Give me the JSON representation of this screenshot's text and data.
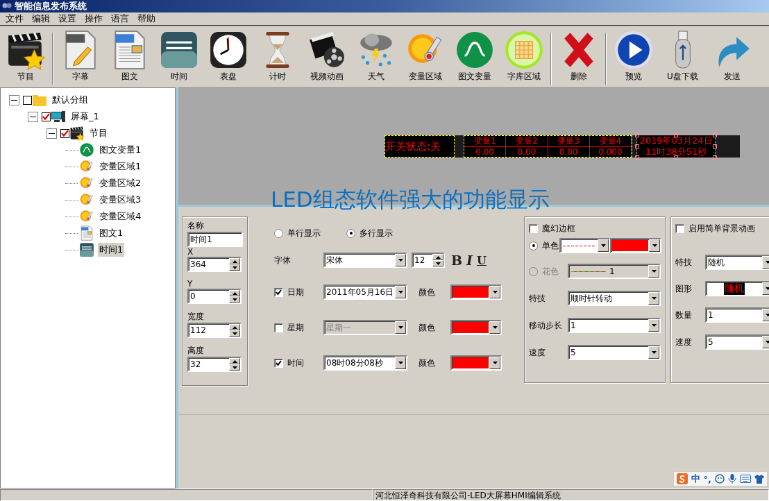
{
  "window": {
    "title": "智能信息发布系统"
  },
  "menu": [
    "文件",
    "编辑",
    "设置",
    "操作",
    "语言",
    "帮助"
  ],
  "toolbar": [
    [
      {
        "label": "节目"
      }
    ],
    [
      {
        "label": "字幕"
      },
      {
        "label": "图文"
      },
      {
        "label": "时间"
      },
      {
        "label": "表盘"
      },
      {
        "label": "计时"
      },
      {
        "label": "视频动画"
      },
      {
        "label": "天气"
      },
      {
        "label": "变量区域"
      },
      {
        "label": "图文变量"
      },
      {
        "label": "字库区域"
      }
    ],
    [
      {
        "label": "删除"
      }
    ],
    [
      {
        "label": "预览"
      },
      {
        "label": "U盘下载"
      },
      {
        "label": "发送"
      }
    ]
  ],
  "tree": [
    {
      "label": "默认分组",
      "kind": "group",
      "checked": false,
      "expanded": true,
      "selected": false,
      "children": [
        {
          "label": "屏幕_1",
          "kind": "screen",
          "checked": true,
          "expanded": true,
          "selected": false,
          "children": [
            {
              "label": "节目",
              "kind": "program",
              "checked": true,
              "expanded": true,
              "selected": false,
              "children": [
                {
                  "label": "图文变量1",
                  "kind": "function",
                  "selected": false
                },
                {
                  "label": "变量区域1",
                  "kind": "variable",
                  "selected": false
                },
                {
                  "label": "变量区域2",
                  "kind": "variable",
                  "selected": false
                },
                {
                  "label": "变量区域3",
                  "kind": "variable",
                  "selected": false
                },
                {
                  "label": "变量区域4",
                  "kind": "variable",
                  "selected": false
                },
                {
                  "label": "图文1",
                  "kind": "document",
                  "selected": false
                },
                {
                  "label": "时间1",
                  "kind": "clock",
                  "selected": true
                }
              ]
            }
          ]
        }
      ]
    }
  ],
  "preview": {
    "switch_text": "开关状态:关",
    "variables": [
      {
        "name": "变量1",
        "value": "0.00"
      },
      {
        "name": "变量2",
        "value": "0.00"
      },
      {
        "name": "变量3",
        "value": "0.00"
      },
      {
        "name": "变量4",
        "value": "0.000"
      }
    ],
    "date_time": {
      "date": "2019年03月24日",
      "time": "11时38分51秒",
      "selected": true
    },
    "caption": "LED组态软件强大的功能显示"
  },
  "object": {
    "fields": [
      {
        "label": "名称",
        "value": "时间1",
        "kind": "text"
      },
      {
        "label": "X",
        "value": "364",
        "kind": "spin"
      },
      {
        "label": "Y",
        "value": "0",
        "kind": "spin"
      },
      {
        "label": "宽度",
        "value": "112",
        "kind": "spin"
      },
      {
        "label": "高度",
        "value": "32",
        "kind": "spin"
      }
    ]
  },
  "display": {
    "modes": [
      {
        "label": "单行显示",
        "selected": false
      },
      {
        "label": "多行显示",
        "selected": true
      }
    ],
    "font_label": "字体",
    "font": "宋体",
    "size": "12",
    "styles": [
      {
        "label": "B",
        "kind": "bold"
      },
      {
        "label": "I",
        "kind": "italic"
      },
      {
        "label": "U",
        "kind": "underline"
      }
    ],
    "parts": [
      {
        "label": "日期",
        "checked": true,
        "value": "2011年05月16日",
        "disabled": false,
        "color_label": "颜色",
        "color": "#ff0000"
      },
      {
        "label": "星期",
        "checked": false,
        "value": "星期一",
        "disabled": true,
        "color_label": "颜色",
        "color": "#ff0000"
      },
      {
        "label": "时间",
        "checked": true,
        "value": "08时08分08秒",
        "disabled": false,
        "color_label": "颜色",
        "color": "#ff0000"
      }
    ]
  },
  "magic_border": {
    "label": "魔幻边框",
    "checked": false,
    "modes": [
      {
        "label": "单色",
        "selected": true,
        "disabled": false,
        "kind": "solid",
        "color": "#ff0000"
      },
      {
        "label": "花色",
        "selected": false,
        "disabled": true,
        "kind": "pattern",
        "value": "1"
      }
    ],
    "rows": [
      {
        "label": "特技",
        "value": "顺时针转动"
      },
      {
        "label": "移动步长",
        "value": "1"
      },
      {
        "label": "速度",
        "value": "5"
      }
    ]
  },
  "background_animation": {
    "label": "启用简单背景动画",
    "checked": false,
    "rows": [
      {
        "label": "特技",
        "value": "随机",
        "kind": "select"
      },
      {
        "label": "图形",
        "value": "随机",
        "kind": "shape"
      },
      {
        "label": "数量",
        "value": "1",
        "kind": "select"
      },
      {
        "label": "速度",
        "value": "5",
        "kind": "select"
      }
    ]
  },
  "ime_bar": {
    "mode": "中",
    "punctuation": "°,"
  },
  "status_bar": {
    "text": "河北恒泽奇科技有限公司-LED大屏幕HMI编辑系统"
  }
}
